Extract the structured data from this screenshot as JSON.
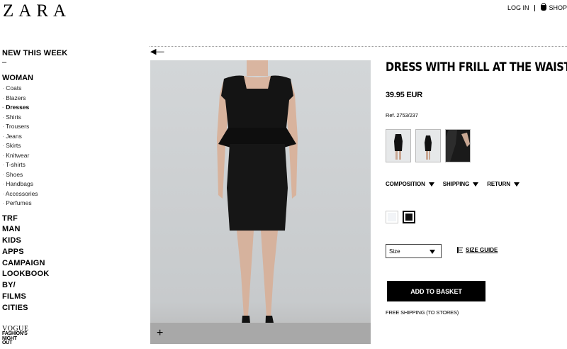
{
  "header": {
    "logo": "ZARA",
    "login_label": "LOG IN",
    "shop_label": "SHOP"
  },
  "sidebar": {
    "new_this_week": "NEW THIS WEEK",
    "dash": "–",
    "woman": "WOMAN",
    "woman_items": [
      "Coats",
      "Blazers",
      "Dresses",
      "Shirts",
      "Trousers",
      "Jeans",
      "Skirts",
      "Knitwear",
      "T-shirts",
      "Shoes",
      "Handbags",
      "Accessories",
      "Perfumes"
    ],
    "active_item": "Dresses",
    "main_items": [
      "TRF",
      "MAN",
      "KIDS",
      "APPS",
      "CAMPAIGN",
      "LOOKBOOK",
      "BY/",
      "FILMS",
      "CITIES"
    ],
    "vogue_logo": "VOGUE",
    "vogue_sub": [
      "FASHION'S",
      "NIGHT",
      "OUT"
    ]
  },
  "product": {
    "title": "DRESS WITH FRILL AT THE WAIST",
    "price": "39.95 EUR",
    "ref": "Ref. 2753/237",
    "tabs": [
      "COMPOSITION",
      "SHIPPING",
      "RETURN"
    ],
    "colors": [
      {
        "name": "white",
        "hex": "#f2f4f7",
        "selected": false
      },
      {
        "name": "black",
        "hex": "#111111",
        "selected": true
      }
    ],
    "size_placeholder": "Size",
    "size_guide": "SIZE GUIDE",
    "add_to_basket": "ADD TO BASKET",
    "free_shipping": "FREE SHIPPING (TO STORES)"
  },
  "icons": {
    "back": "left-arrow-icon",
    "zoom": "plus-icon",
    "bag": "shopping-bag-icon",
    "dropdown": "triangle-down-icon",
    "size_guide": "ruler-icon"
  },
  "colors": {
    "background": "#ffffff",
    "text": "#000000",
    "button_bg": "#000000",
    "button_text": "#ffffff",
    "photo_bg": "#cfd2d4"
  }
}
